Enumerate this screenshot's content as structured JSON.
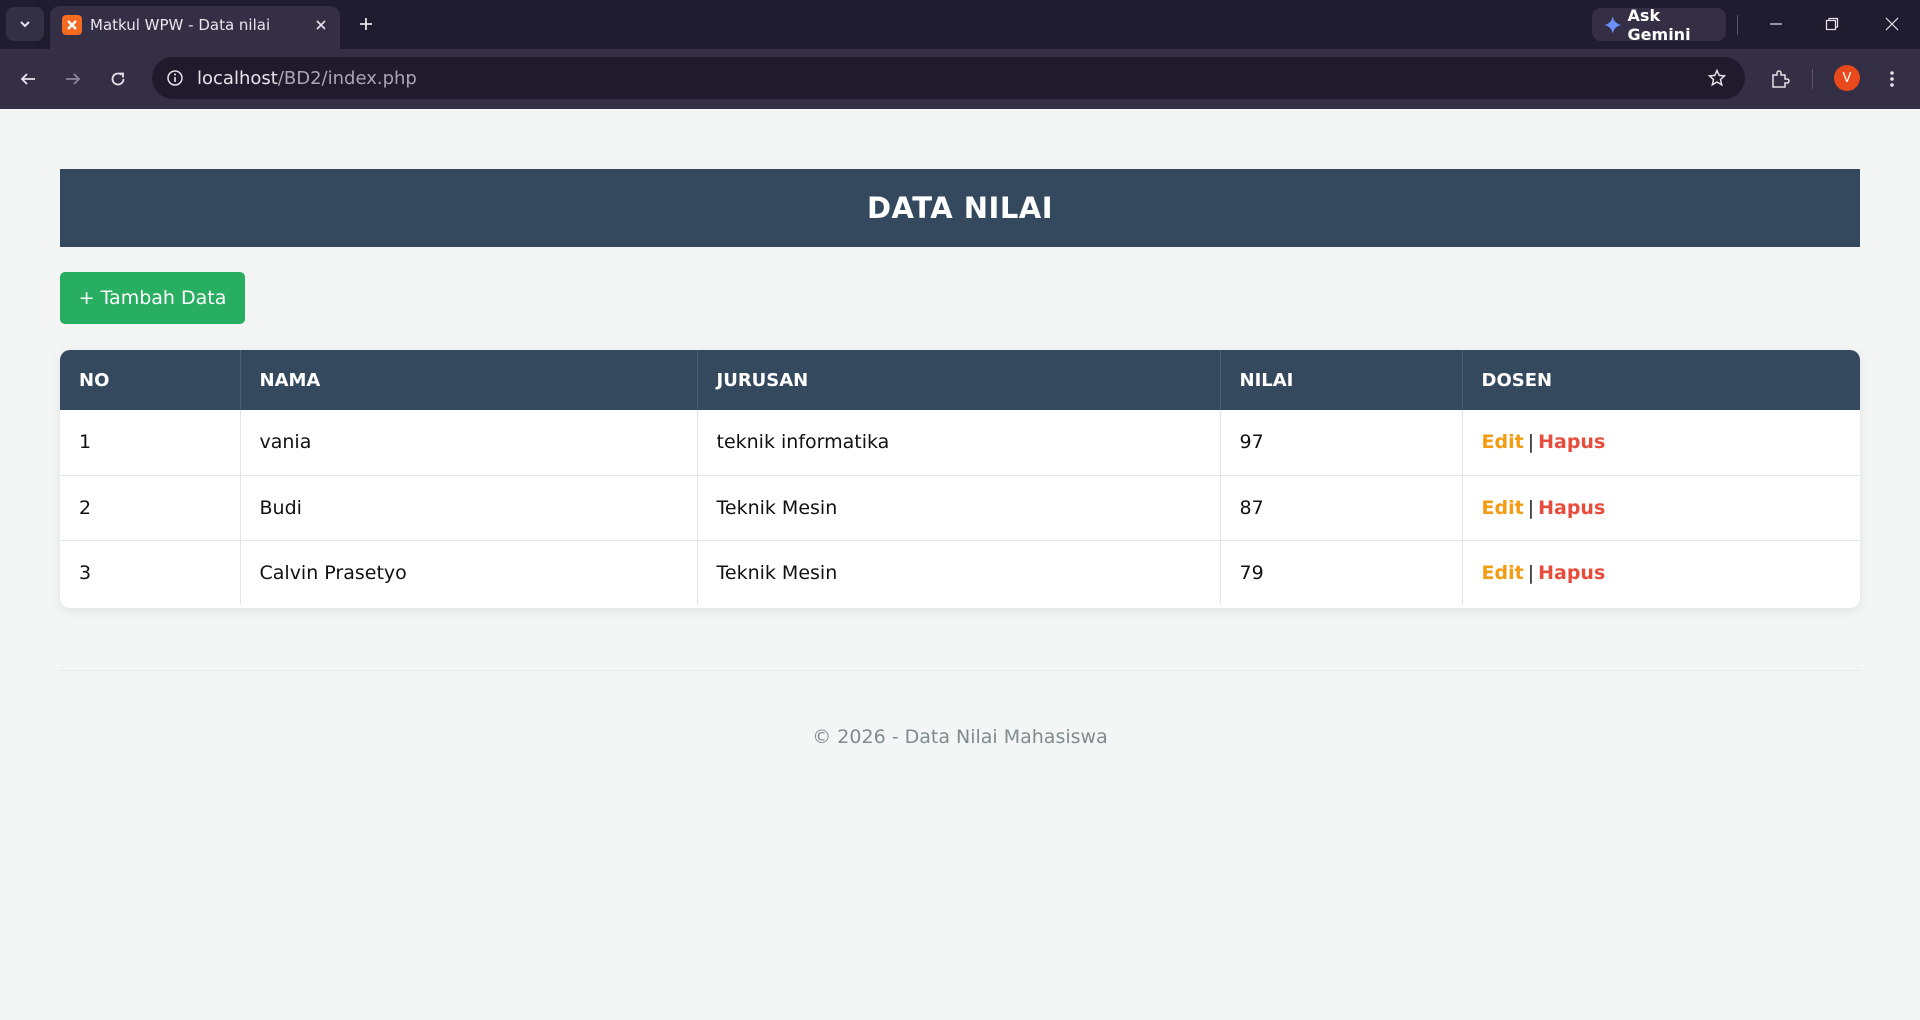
{
  "browser": {
    "tab_title": "Matkul WPW - Data nilai",
    "gemini_label": "Ask Gemini",
    "url_host": "localhost",
    "url_path": "/BD2/index.php",
    "profile_initial": "V",
    "icons": [
      "tab-list-icon",
      "xampp-favicon-icon",
      "close-icon",
      "plus-icon",
      "gemini-icon",
      "minimize-icon",
      "restore-icon",
      "back-icon",
      "forward-icon",
      "reload-icon",
      "site-info-icon",
      "star-icon",
      "extensions-icon",
      "menu-icon"
    ]
  },
  "page": {
    "title": "DATA NILAI",
    "add_button": "+ Tambah Data",
    "table": {
      "headers": [
        "NO",
        "NAMA",
        "JURUSAN",
        "NILAI",
        "DOSEN"
      ],
      "rows": [
        {
          "no": "1",
          "nama": "vania",
          "jurusan": "teknik informatika",
          "nilai": "97"
        },
        {
          "no": "2",
          "nama": "Budi",
          "jurusan": "Teknik Mesin",
          "nilai": "87"
        },
        {
          "no": "3",
          "nama": "Calvin Prasetyo",
          "jurusan": "Teknik Mesin",
          "nilai": "79"
        }
      ],
      "edit_label": "Edit",
      "separator": "|",
      "delete_label": "Hapus"
    },
    "footer": "© 2026 - Data Nilai Mahasiswa"
  },
  "colors": {
    "header_bg": "#34495e",
    "add_button": "#27ae60",
    "edit_link": "#f39c12",
    "delete_link": "#e74c3c"
  }
}
